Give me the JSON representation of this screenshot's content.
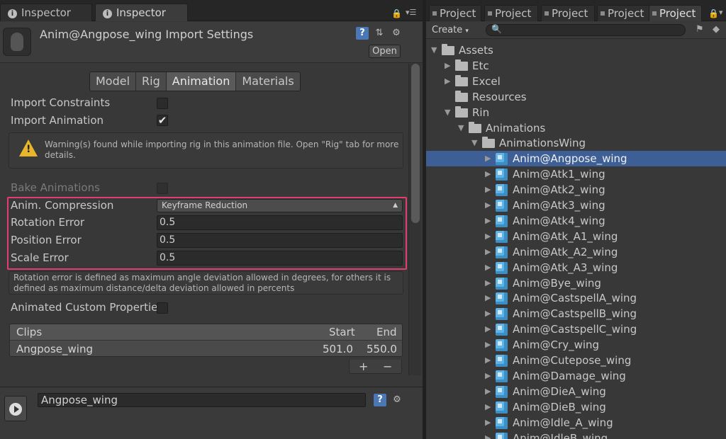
{
  "inspector": {
    "tabs": [
      "Inspector",
      "Inspector"
    ],
    "title": "Anim@Angpose_wing Import Settings",
    "open_label": "Open",
    "subtabs": [
      "Model",
      "Rig",
      "Animation",
      "Materials"
    ],
    "import_constraints_label": "Import Constraints",
    "import_animation_label": "Import Animation",
    "warning_text": "Warning(s) found while importing rig in this animation file. Open \"Rig\" tab for more details.",
    "bake_animations_label": "Bake Animations",
    "anim_compression_label": "Anim. Compression",
    "anim_compression_value": "Keyframe Reduction",
    "rotation_error_label": "Rotation Error",
    "rotation_error_value": "0.5",
    "position_error_label": "Position Error",
    "position_error_value": "0.5",
    "scale_error_label": "Scale Error",
    "scale_error_value": "0.5",
    "error_note": "Rotation error is defined as maximum angle deviation allowed in degrees, for others it is defined as maximum distance/delta deviation allowed in percents",
    "animated_custom_label": "Animated Custom Propertie",
    "clips_header": "Clips",
    "start_header": "Start",
    "end_header": "End",
    "clip_name": "Angpose_wing",
    "clip_start": "501.0",
    "clip_end": "550.0",
    "plus": "+",
    "minus": "−",
    "clip_field_value": "Angpose_wing",
    "import_constraints_checked": false,
    "import_animation_checked": true,
    "highlight_color": "#e23d6e"
  },
  "project": {
    "tabs": [
      "Project",
      "Project",
      "Project",
      "Project",
      "Project"
    ],
    "create_label": "Create",
    "tree": [
      {
        "label": "Assets",
        "kind": "folder",
        "depth": 0,
        "expanded": true
      },
      {
        "label": "Etc",
        "kind": "folder",
        "depth": 1,
        "expanded": false
      },
      {
        "label": "Excel",
        "kind": "folder",
        "depth": 1,
        "expanded": false
      },
      {
        "label": "Resources",
        "kind": "folder",
        "depth": 1,
        "leaf": true
      },
      {
        "label": "Rin",
        "kind": "folder",
        "depth": 1,
        "expanded": true
      },
      {
        "label": "Animations",
        "kind": "folder",
        "depth": 2,
        "expanded": true
      },
      {
        "label": "AnimationsWing",
        "kind": "folder",
        "depth": 3,
        "expanded": true
      },
      {
        "label": "Anim@Angpose_wing",
        "kind": "model",
        "depth": 4,
        "selected": true
      },
      {
        "label": "Anim@Atk1_wing",
        "kind": "model",
        "depth": 4
      },
      {
        "label": "Anim@Atk2_wing",
        "kind": "model",
        "depth": 4
      },
      {
        "label": "Anim@Atk3_wing",
        "kind": "model",
        "depth": 4
      },
      {
        "label": "Anim@Atk4_wing",
        "kind": "model",
        "depth": 4
      },
      {
        "label": "Anim@Atk_A1_wing",
        "kind": "model",
        "depth": 4
      },
      {
        "label": "Anim@Atk_A2_wing",
        "kind": "model",
        "depth": 4
      },
      {
        "label": "Anim@Atk_A3_wing",
        "kind": "model",
        "depth": 4
      },
      {
        "label": "Anim@Bye_wing",
        "kind": "model",
        "depth": 4
      },
      {
        "label": "Anim@CastspellA_wing",
        "kind": "model",
        "depth": 4
      },
      {
        "label": "Anim@CastspellB_wing",
        "kind": "model",
        "depth": 4
      },
      {
        "label": "Anim@CastspellC_wing",
        "kind": "model",
        "depth": 4
      },
      {
        "label": "Anim@Cry_wing",
        "kind": "model",
        "depth": 4
      },
      {
        "label": "Anim@Cutepose_wing",
        "kind": "model",
        "depth": 4
      },
      {
        "label": "Anim@Damage_wing",
        "kind": "model",
        "depth": 4
      },
      {
        "label": "Anim@DieA_wing",
        "kind": "model",
        "depth": 4
      },
      {
        "label": "Anim@DieB_wing",
        "kind": "model",
        "depth": 4
      },
      {
        "label": "Anim@Idle_A_wing",
        "kind": "model",
        "depth": 4
      },
      {
        "label": "Anim@IdleB_wing",
        "kind": "model",
        "depth": 4
      }
    ]
  }
}
